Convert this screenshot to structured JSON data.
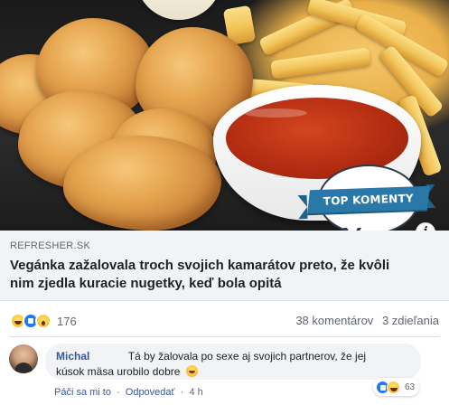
{
  "preview": {
    "domain": "REFRESHER.SK",
    "title": "Vegánka zažalovala troch svojich kamarátov preto, že kvôli nim zjedla kuracie nugetky, keď bola opitá",
    "badge_label": "TOP KOMENTY",
    "info_icon": "i"
  },
  "reactions": {
    "icons": [
      "haha-icon",
      "like-icon",
      "wow-icon"
    ],
    "count": "176"
  },
  "stats": {
    "comments": "38 komentárov",
    "shares": "3 zdieľania"
  },
  "comment": {
    "author": "Michal",
    "text_line1": "Tá by žalovala po sexe aj svojich partnerov, že jej",
    "text_line2": "kúsok mäsa urobilo dobre",
    "like_action": "Páči sa mi to",
    "reply_action": "Odpovedať",
    "time": "4 h",
    "separator": "·",
    "reaction_count": "63"
  },
  "colors": {
    "link_blue": "#385898",
    "badge_blue": "#2a78a8",
    "preview_bg": "#f2f3f5",
    "secondary_text": "#606770"
  }
}
